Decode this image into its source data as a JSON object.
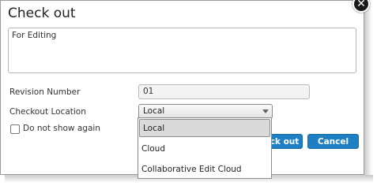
{
  "dialog": {
    "title": "Check out",
    "comment_value": "For Editing",
    "revision_label": "Revision Number",
    "revision_value": "01",
    "location_label": "Checkout Location",
    "location_selected": "Local",
    "dont_show_label": "Do not show again",
    "checkout_button_label": "ck out",
    "cancel_button_label": "Cancel",
    "close_icon": "close-icon"
  },
  "dropdown": {
    "options": [
      "Local",
      "Cloud",
      "Collaborative Edit Cloud"
    ],
    "selected_index": 0
  },
  "colors": {
    "accent": "#1e7fc4",
    "selected_option_bg": "#dadada"
  }
}
